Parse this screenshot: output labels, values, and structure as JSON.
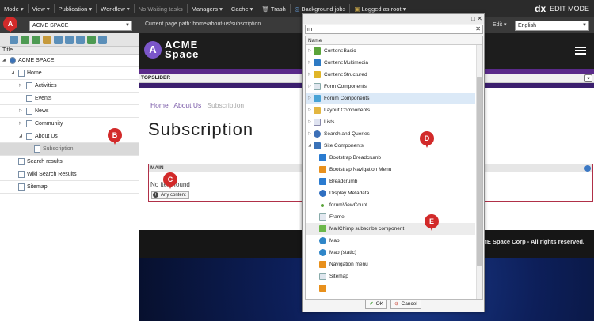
{
  "topbar": {
    "items": [
      "Mode ▾",
      "View ▾",
      "Publication ▾",
      "Workflow ▾",
      "No Waiting tasks",
      "Managers ▾",
      "Cache ▾",
      "Trash",
      "Background jobs",
      "Logged as root ▾"
    ],
    "logo_mark": "dx",
    "logo_text": "EDIT MODE"
  },
  "secondary": {
    "site_select": "ACME SPACE",
    "page_path": "Current page path: home/about-us/subscription",
    "edit_label": "Edit ▾",
    "language": "English"
  },
  "tree": {
    "header": "Title",
    "nodes": [
      "ACME SPACE",
      "Home",
      "Activities",
      "Events",
      "News",
      "Community",
      "About Us",
      "Subscription",
      "Search results",
      "Wiki Search Results",
      "Sitemap"
    ]
  },
  "page": {
    "logo_mark": "A",
    "logo_line1": "ACME",
    "logo_line2": "Space",
    "topslider": "TOPSLIDER",
    "crumbs": [
      "Home",
      "About Us",
      "Subscription"
    ],
    "title": "Subscription",
    "zone_label": "MAIN",
    "zone_text": "No item found",
    "any_content": "Any content",
    "footer": "© ACME Space Corp - All rights reserved."
  },
  "dialog": {
    "search_value": "m",
    "column": "Name",
    "categories": [
      "Content:Basic",
      "Content:Multimedia",
      "Content:Structured",
      "Form Components",
      "Forum Components",
      "Layout Components",
      "Lists",
      "Search and Queries",
      "Site Components"
    ],
    "children": [
      "Bootstrap Breadcrumb",
      "Bootstrap Navigation Menu",
      "Breadcrumb",
      "Display Metadata",
      "forumViewCount",
      "Frame",
      "MailChimp subscribe component",
      "Map",
      "Map (static)",
      "Navigation menu",
      "Sitemap"
    ],
    "ok_label": "OK",
    "cancel_label": "Cancel"
  },
  "markers": [
    "A",
    "B",
    "C",
    "D",
    "E"
  ]
}
